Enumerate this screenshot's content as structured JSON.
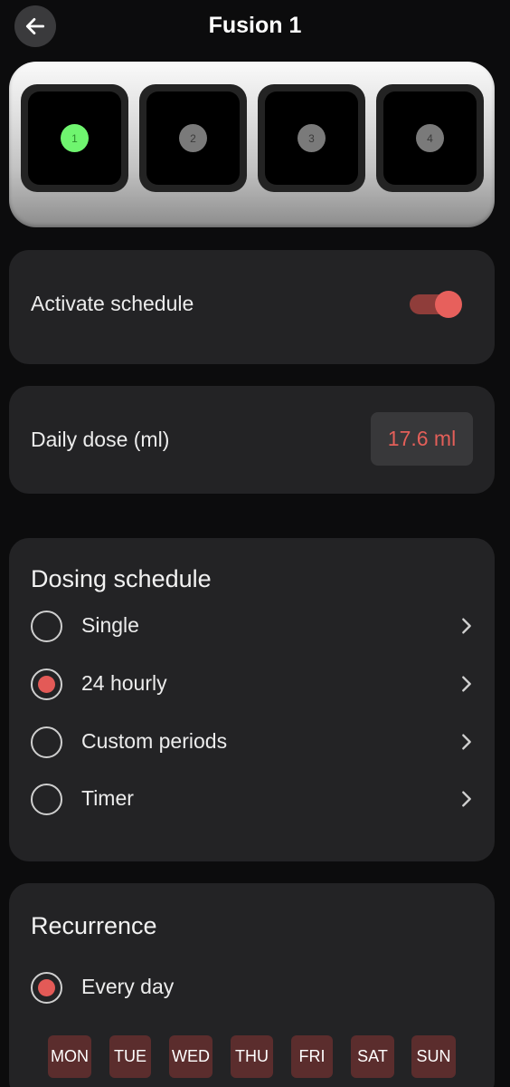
{
  "header": {
    "title": "Fusion 1"
  },
  "device": {
    "channels": [
      "1",
      "2",
      "3",
      "4"
    ]
  },
  "schedule": {
    "label": "Activate schedule",
    "enabled": true
  },
  "dose": {
    "label": "Daily dose (ml)",
    "value": "17.6 ml"
  },
  "dosing": {
    "title": "Dosing schedule",
    "options": [
      "Single",
      "24 hourly",
      "Custom periods",
      "Timer"
    ],
    "selected": "24 hourly"
  },
  "recurrence": {
    "title": "Recurrence",
    "option": "Every day",
    "days": [
      "MON",
      "TUE",
      "WED",
      "THU",
      "FRI",
      "SAT",
      "SUN"
    ]
  },
  "colors": {
    "accent": "#e35f59",
    "active_led": "#6ff56f",
    "card": "#232325",
    "background": "#0c0c0d"
  }
}
